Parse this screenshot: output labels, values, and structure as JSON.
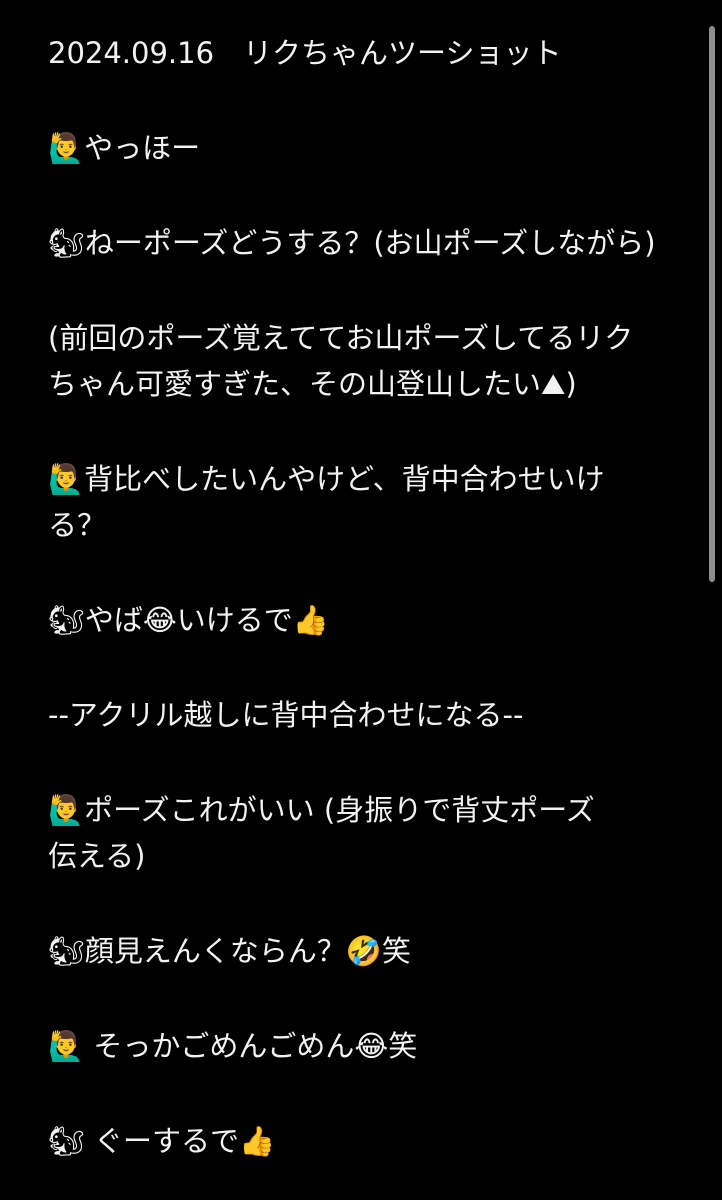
{
  "note": {
    "lines": [
      "2024.09.16　リクちゃんツーショット",
      "",
      "🙋‍♂️やっほー",
      "",
      "🐿ねーポーズどうする？(お山ポーズしながら)",
      "",
      "(前回のポーズ覚えててお山ポーズしてるリク",
      "ちゃん可愛すぎた、その山登山したい⛰)",
      "",
      "🙋‍♂️背比べしたいんやけど、背中合わせいけ",
      "る？",
      "",
      "🐿やば😂いけるで👍",
      "",
      "--アクリル越しに背中合わせになる--",
      "",
      "🙋‍♂️ポーズこれがいい (身振りで背丈ポーズ",
      "伝える)",
      "",
      "🐿顔見えんくならん？🤣笑",
      "",
      "🙋‍♂️ そっかごめんごめん😂笑",
      "",
      "🐿 ぐーするで👍"
    ]
  },
  "colors": {
    "background": "#000000",
    "text": "#f2f2f2",
    "scrollbar": "#8e8e8e"
  }
}
